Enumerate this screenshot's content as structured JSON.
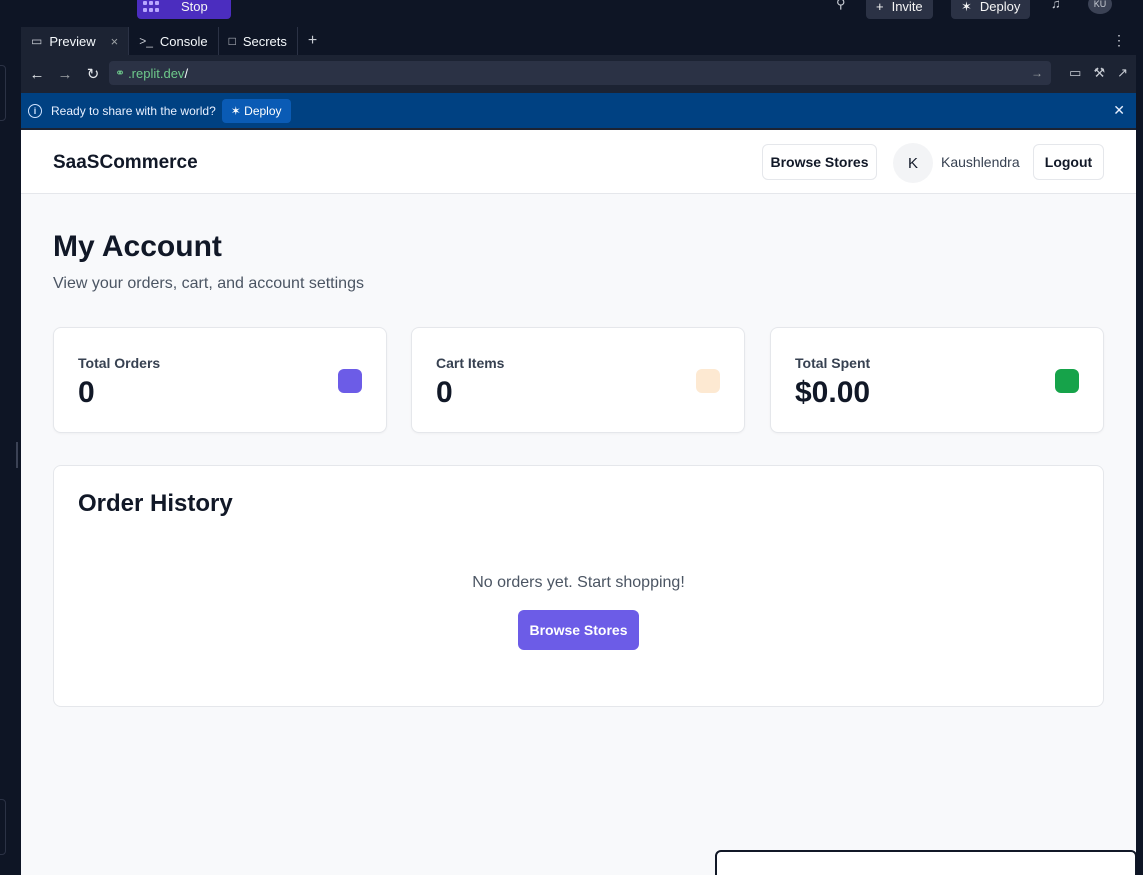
{
  "ide": {
    "stop_label": "Stop",
    "invite_label": "Invite",
    "deploy_label": "Deploy",
    "avatar_initials": "KU",
    "icons": [
      "search-icon",
      "bell-icon",
      "invite-icon",
      "deploy-icon"
    ]
  },
  "tabs": [
    {
      "label": "Preview",
      "icon": "monitor-icon"
    },
    {
      "label": "Console",
      "icon": "terminal-icon"
    },
    {
      "label": "Secrets",
      "icon": "lock-icon"
    }
  ],
  "url": {
    "host": ".replit.dev",
    "path": "/"
  },
  "banner": {
    "message": "Ready to share with the world?",
    "deploy_label": "Deploy"
  },
  "app": {
    "brand": "SaaSCommerce",
    "browse_label": "Browse Stores",
    "user_initial": "K",
    "user_name": "Kaushlendra",
    "logout_label": "Logout",
    "title": "My Account",
    "subtitle": "View your orders, cart, and account settings",
    "stats": [
      {
        "label": "Total Orders",
        "value": "0",
        "color": "#6c5ce7"
      },
      {
        "label": "Cart Items",
        "value": "0",
        "color": "#fde9d2"
      },
      {
        "label": "Total Spent",
        "value": "$0.00",
        "color": "#16a34a"
      }
    ],
    "orders": {
      "title": "Order History",
      "empty_text": "No orders yet. Start shopping!",
      "cta_label": "Browse Stores"
    }
  }
}
